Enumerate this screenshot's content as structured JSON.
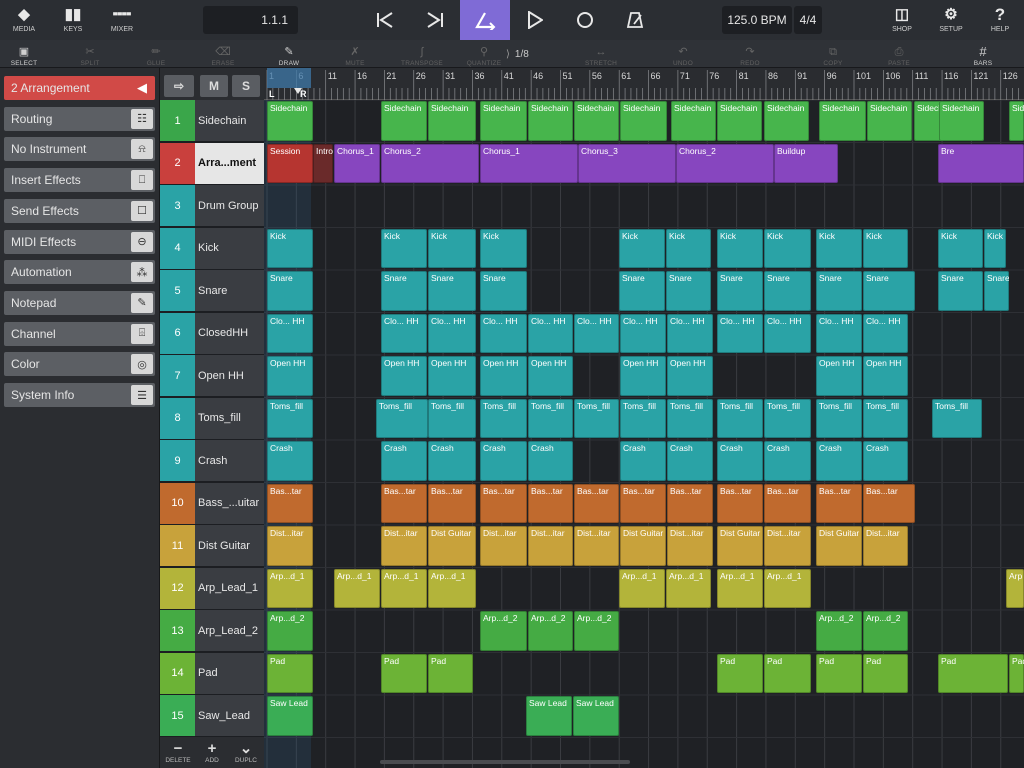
{
  "topbar": {
    "media": "MEDIA",
    "keys": "KEYS",
    "mixer": "MIXER",
    "position": "1.1.1",
    "tempo": "125.0 BPM",
    "signature": "4/4",
    "shop": "SHOP",
    "setup": "SETUP",
    "help": "HELP"
  },
  "toolbar": {
    "select": "SELECT",
    "split": "SPLIT",
    "glue": "GLUE",
    "erase": "ERASE",
    "draw": "DRAW",
    "mute": "MUTE",
    "transpose": "TRANSPOSE",
    "quantize": "QUANTIZE",
    "quantize_value": "1/8",
    "stretch": "STRETCH",
    "undo": "UNDO",
    "redo": "REDO",
    "copy": "COPY",
    "paste": "PASTE",
    "bars": "BARS"
  },
  "inspector": {
    "items": [
      "2  Arrangement",
      "Routing",
      "No Instrument",
      "Insert Effects",
      "Send Effects",
      "MIDI Effects",
      "Automation",
      "Notepad",
      "Channel",
      "Color",
      "System Info"
    ],
    "icons": [
      "collapse-arrow-icon",
      "routing-icon",
      "instrument-icon",
      "insert-effects-icon",
      "send-effects-icon",
      "midi-effects-icon",
      "automation-icon",
      "notepad-icon",
      "channel-icon",
      "color-icon",
      "menu-icon"
    ]
  },
  "track_header": {
    "mute": "M",
    "solo": "S"
  },
  "tracks": [
    {
      "num": "1",
      "name": "Sidechain",
      "color": "#3aa64a"
    },
    {
      "num": "2",
      "name": "Arra...ment",
      "color": "#c9403d"
    },
    {
      "num": "3",
      "name": "Drum Group",
      "color": "#2aa3a6"
    },
    {
      "num": "4",
      "name": "Kick",
      "color": "#2aa3a6"
    },
    {
      "num": "5",
      "name": "Snare",
      "color": "#2aa3a6"
    },
    {
      "num": "6",
      "name": "ClosedHH",
      "color": "#2aa3a6"
    },
    {
      "num": "7",
      "name": "Open HH",
      "color": "#2aa3a6"
    },
    {
      "num": "8",
      "name": "Toms_fill",
      "color": "#2aa3a6"
    },
    {
      "num": "9",
      "name": "Crash",
      "color": "#2aa3a6"
    },
    {
      "num": "10",
      "name": "Bass_...uitar",
      "color": "#c06a2e"
    },
    {
      "num": "11",
      "name": "Dist Guitar",
      "color": "#c8a23b"
    },
    {
      "num": "12",
      "name": "Arp_Lead_1",
      "color": "#b3b43a"
    },
    {
      "num": "13",
      "name": "Arp_Lead_2",
      "color": "#45ab44"
    },
    {
      "num": "14",
      "name": "Pad",
      "color": "#6cb336"
    },
    {
      "num": "15",
      "name": "Saw_Lead",
      "color": "#3aad55"
    }
  ],
  "footer": {
    "delete": "DELETE",
    "add": "ADD",
    "duplicate": "DUPLC"
  },
  "ruler": {
    "bars": [
      "1",
      "6",
      "11",
      "16",
      "21",
      "26",
      "31",
      "36",
      "41",
      "46",
      "51",
      "56",
      "61",
      "66",
      "71",
      "76",
      "81",
      "86",
      "91",
      "96",
      "101",
      "106",
      "111",
      "116",
      "121",
      "126"
    ],
    "locator_left": "L",
    "locator_right": "R"
  },
  "clips": {
    "t1": [
      "Sidechain",
      "Sidechain",
      "Sidechain",
      "Sidechain",
      "Sidechain",
      "Sidechain",
      "Sidechain",
      "Sidechain",
      "Sidechain",
      "Sidechain",
      "Sidechain",
      "Sidechain",
      "Sidechain",
      "Sidechain",
      "Sid"
    ],
    "t2": [
      "Session",
      "Intro",
      "Chorus_1",
      "Chorus_2",
      "Chorus_1",
      "Chorus_3",
      "Chorus_2",
      "Buildup",
      "Bre"
    ],
    "t4": [
      "Kick",
      "Kick",
      "Kick",
      "Kick",
      "Kick",
      "Kick",
      "Kick",
      "Kick",
      "Kick",
      "Kick",
      "Kick",
      "Kick"
    ],
    "t5": [
      "Snare",
      "Snare",
      "Snare",
      "Snare",
      "Snare",
      "Snare",
      "Snare",
      "Snare",
      "Snare",
      "Snare",
      "Snare",
      "Snare"
    ],
    "t6": [
      "Clo... HH",
      "Clo... HH",
      "Clo... HH",
      "Clo... HH",
      "Clo... HH",
      "Clo... HH",
      "Clo... HH",
      "Clo... HH",
      "Clo... HH",
      "Clo... HH",
      "Clo... HH",
      "Clo... HH"
    ],
    "t7": [
      "Open HH",
      "Open HH",
      "Open HH",
      "Open HH",
      "Open HH",
      "Open HH",
      "Open HH",
      "Open HH",
      "Open HH"
    ],
    "t8": [
      "Toms_fill",
      "Toms_fill",
      "Toms_fill",
      "Toms_fill",
      "Toms_fill",
      "Toms_fill",
      "Toms_fill",
      "Toms_fill",
      "Toms_fill",
      "Toms_fill",
      "Toms_fill",
      "Toms_fill",
      "Toms_fill"
    ],
    "t9": [
      "Crash",
      "Crash",
      "Crash",
      "Crash",
      "Crash",
      "Crash",
      "Crash",
      "Crash",
      "Crash",
      "Crash",
      "Crash"
    ],
    "t10": [
      "Bas...tar",
      "Bas...tar",
      "Bas...tar",
      "Bas...tar",
      "Bas...tar",
      "Bas...tar",
      "Bas...tar",
      "Bas...tar",
      "Bas...tar",
      "Bas...tar",
      "Bas...tar",
      "Bas...tar"
    ],
    "t11": [
      "Dist...itar",
      "Dist...itar",
      "Dist Guitar",
      "Dist...itar",
      "Dist...itar",
      "Dist...itar",
      "Dist Guitar",
      "Dist...itar",
      "Dist Guitar",
      "Dist...itar",
      "Dist Guitar",
      "Dist...itar"
    ],
    "t12": [
      "Arp...d_1",
      "Arp...d_1",
      "Arp...d_1",
      "Arp...d_1",
      "Arp...d_1",
      "Arp...d_1",
      "Arp...d_1",
      "Arp...d_1",
      "Arp"
    ],
    "t13": [
      "Arp...d_2",
      "Arp...d_2",
      "Arp...d_2",
      "Arp...d_2",
      "Arp...d_2",
      "Arp...d_2"
    ],
    "t14": [
      "Pad",
      "Pad",
      "Pad",
      "Pad",
      "Pad",
      "Pad",
      "Pad",
      "Pad",
      "Pad"
    ],
    "t15": [
      "Saw Lead",
      "Saw Lead",
      "Saw Lead"
    ]
  },
  "colors": {
    "loop_active": "#7f6bd6",
    "inspector_selected": "#d14a47",
    "sidechain": "#47b54c",
    "arrangement_session": "#b63530",
    "arrangement_part": "#8746bf",
    "drums": "#2aa3a6",
    "bass": "#c06a2e",
    "guitar": "#c8a23b",
    "arp1": "#b3b43a",
    "arp2": "#45ab44",
    "pad": "#6cb336",
    "saw": "#3aad55"
  }
}
